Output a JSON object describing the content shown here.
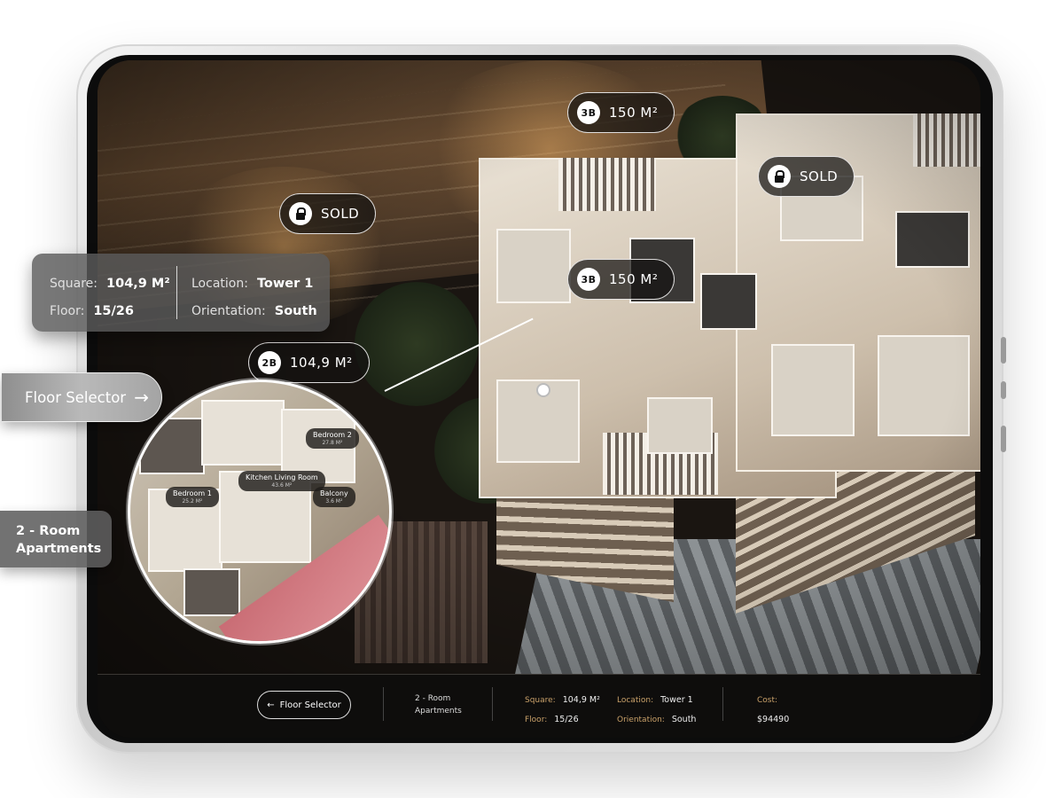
{
  "map_tags": [
    {
      "badge": "3B",
      "label": "150 M²"
    },
    {
      "badge": "",
      "label": "SOLD"
    },
    {
      "badge": "",
      "label": "SOLD"
    },
    {
      "badge": "3B",
      "label": "150 M²"
    },
    {
      "badge": "2B",
      "label": "104,9 M²"
    }
  ],
  "info_card": {
    "square_label": "Square:",
    "square_value": "104,9 M²",
    "floor_label": "Floor:",
    "floor_value": "15/26",
    "location_label": "Location:",
    "location_value": "Tower 1",
    "orientation_label": "Orientation:",
    "orientation_value": "South"
  },
  "floor_selector": {
    "label": "Floor Selector",
    "icon": "arrow-right-icon"
  },
  "apartment_type": {
    "line1": "2 - Room",
    "line2": "Apartments"
  },
  "zoom_rooms": [
    {
      "name": "Bedroom 2",
      "size": "27.8 M²"
    },
    {
      "name": "Kitchen Living Room",
      "size": "43.6 M²"
    },
    {
      "name": "Bedroom 1",
      "size": "25.2 M²"
    },
    {
      "name": "Balcony",
      "size": "3.6 M²"
    }
  ],
  "bottom_bar": {
    "back_label": "Floor Selector",
    "back_icon": "arrow-left-icon",
    "apartment_line1": "2 - Room",
    "apartment_line2": "Apartments",
    "square_label": "Square:",
    "square_value": "104,9 M²",
    "floor_label": "Floor:",
    "floor_value": "15/26",
    "location_label": "Location:",
    "location_value": "Tower 1",
    "orientation_label": "Orientation:",
    "orientation_value": "South",
    "cost_label": "Cost:",
    "cost_value": "$94490"
  },
  "colors": {
    "accent_gold": "#c9a16a",
    "bar_bg": "#0e0d0c"
  }
}
